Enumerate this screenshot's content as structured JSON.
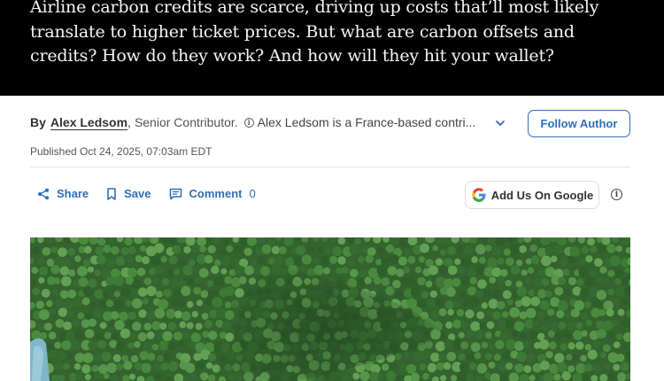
{
  "hero": {
    "text": "Airline carbon credits are scarce, driving up costs that’ll most likely translate to higher ticket prices. But what are carbon offsets and credits? How do they work? And how will they hit your wallet?"
  },
  "byline": {
    "by": "By",
    "author": "Alex Ledsom",
    "comma": ",",
    "role": "Senior Contributor.",
    "bio": "Alex Ledsom is a France-based contri..."
  },
  "follow": {
    "label": "Follow Author"
  },
  "published": "Published Oct 24, 2025, 07:03am EDT",
  "actions": {
    "share": "Share",
    "save": "Save",
    "comment": "Comment",
    "comment_count": "0"
  },
  "google": {
    "label": "Add Us On Google"
  },
  "colors": {
    "accent": "#2d6fb5",
    "hero_bg": "#000000"
  },
  "icons": [
    "chevron-down-icon",
    "info-icon",
    "share-icon",
    "bookmark-icon",
    "comment-icon",
    "google-icon"
  ]
}
